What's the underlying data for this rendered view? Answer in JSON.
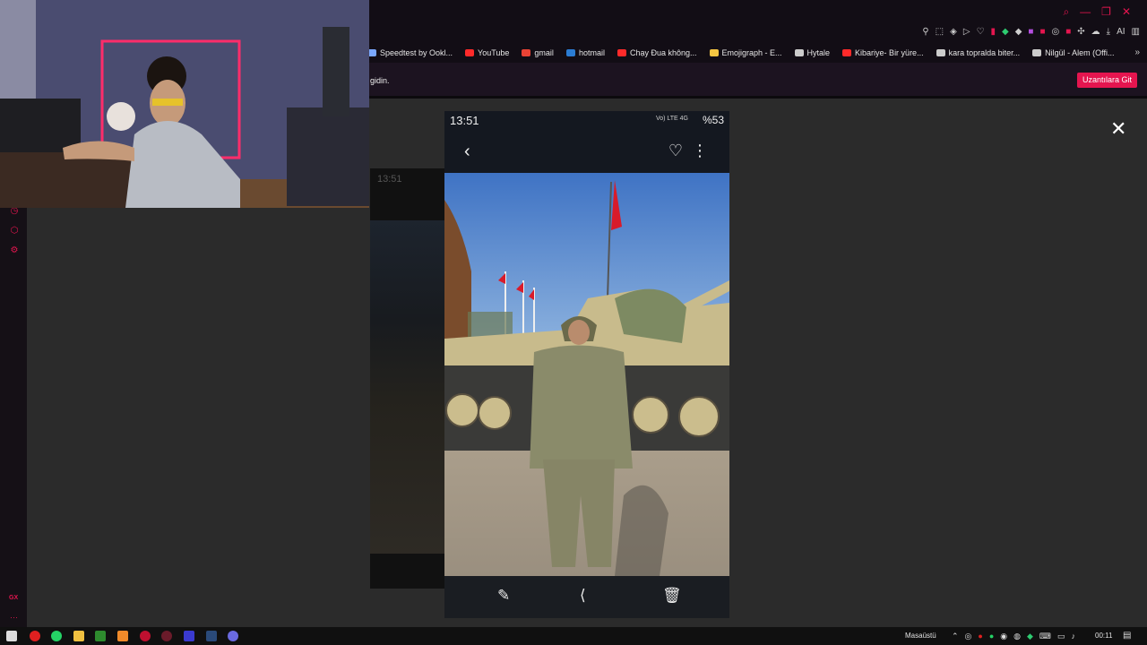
{
  "browser": {
    "bookmarks": [
      {
        "label": "Speedtest by Ookl...",
        "color": "#7aa7ff"
      },
      {
        "label": "YouTube",
        "color": "#ff2a2a"
      },
      {
        "label": "gmail",
        "color": "#ea4335"
      },
      {
        "label": "hotmail",
        "color": "#2b7cd3"
      },
      {
        "label": "Chạy Đua không...",
        "color": "#ff2a2a"
      },
      {
        "label": "Emojigraph - E...",
        "color": "#f5c542"
      },
      {
        "label": "Hytale",
        "color": "#cccccc"
      },
      {
        "label": "Kibariye- Bir yüre...",
        "color": "#ff2a2a"
      },
      {
        "label": "kara topralda biter...",
        "color": "#cccccc"
      },
      {
        "label": "Nilgül - Alem (Offi...",
        "color": "#cccccc"
      }
    ],
    "notice_text": "gidin.",
    "notice_button": "Uzantılara Git",
    "ai_label": "AI"
  },
  "sidebar": {
    "gx_label": "GX",
    "more_label": "···"
  },
  "dimmed": {
    "time": "13:51"
  },
  "phone": {
    "time": "13:51",
    "signal": "Vo) LTE 4G",
    "battery": "%53",
    "back_icon": "chevron-left-icon",
    "favorite_icon": "heart-icon",
    "menu_icon": "more-vertical-icon",
    "bottom_actions": [
      "edit-icon",
      "share-icon",
      "delete-icon"
    ]
  },
  "viewer": {
    "close_icon": "close-icon"
  },
  "taskbar": {
    "desktop_label": "Masaüstü",
    "clock": "00:11"
  }
}
